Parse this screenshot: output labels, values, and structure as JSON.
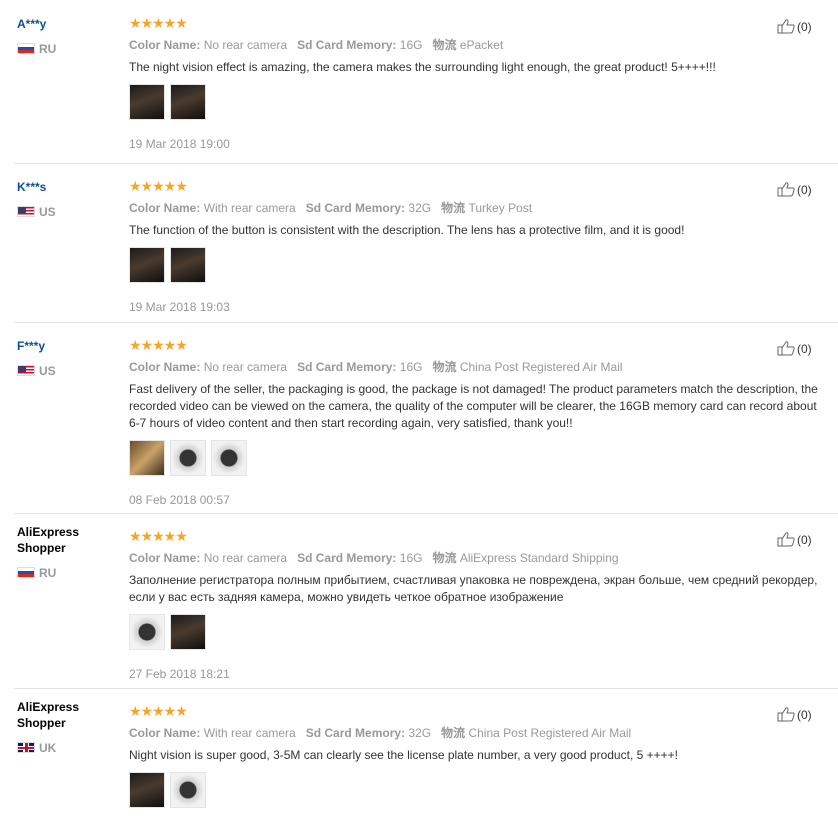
{
  "reviews": [
    {
      "user": "A***y",
      "shopper": false,
      "country": "RU",
      "flag": "ru",
      "stars": "★★★★★",
      "attrs": [
        {
          "key": "Color Name:",
          "val": "No rear camera"
        },
        {
          "key": "Sd Card Memory:",
          "val": "16G"
        },
        {
          "key": "物流",
          "val": "ePacket"
        }
      ],
      "text": "The night vision effect is amazing, the camera makes the surrounding light enough, the great product! 5++++!!!",
      "thumbs": [
        "dark",
        "dark"
      ],
      "date": "19 Mar 2018 19:00",
      "helpful": "(0)"
    },
    {
      "user": "K***s",
      "shopper": false,
      "country": "US",
      "flag": "us",
      "stars": "★★★★★",
      "attrs": [
        {
          "key": "Color Name:",
          "val": "With rear camera"
        },
        {
          "key": "Sd Card Memory:",
          "val": "32G"
        },
        {
          "key": "物流",
          "val": "Turkey Post"
        }
      ],
      "text": "The function of the button is consistent with the description. The lens has a protective film, and it is good!",
      "thumbs": [
        "dark",
        "dark"
      ],
      "date": "19 Mar 2018 19:03",
      "helpful": "(0)"
    },
    {
      "user": "F***y",
      "shopper": false,
      "country": "US",
      "flag": "us",
      "stars": "★★★★★",
      "attrs": [
        {
          "key": "Color Name:",
          "val": "No rear camera"
        },
        {
          "key": "Sd Card Memory:",
          "val": "16G"
        },
        {
          "key": "物流",
          "val": "China Post Registered Air Mail"
        }
      ],
      "text": "Fast delivery of the seller, the packaging is good, the package is not damaged! The product parameters match the description, the recorded video can be viewed on the camera, the quality of the computer will be clearer, the 16GB memory card can record about 6-7 hours of video content and then start recording again, very satisfied, thank you!!",
      "thumbs": [
        "warm",
        "light",
        "light"
      ],
      "date": "08 Feb 2018 00:57",
      "helpful": "(0)"
    },
    {
      "user": "AliExpress Shopper",
      "shopper": true,
      "country": "RU",
      "flag": "ru",
      "stars": "★★★★★",
      "attrs": [
        {
          "key": "Color Name:",
          "val": "No rear camera"
        },
        {
          "key": "Sd Card Memory:",
          "val": "16G"
        },
        {
          "key": "物流",
          "val": "AliExpress Standard Shipping"
        }
      ],
      "text": "Заполнение регистратора полным прибытием, счастливая упаковка не повреждена, экран больше, чем средний рекордер, если у вас есть задняя камера, можно увидеть четкое обратное изображение",
      "thumbs": [
        "light",
        "dark"
      ],
      "date": "27 Feb 2018 18:21",
      "helpful": "(0)"
    },
    {
      "user": "AliExpress Shopper",
      "shopper": true,
      "country": "UK",
      "flag": "uk",
      "stars": "★★★★★",
      "attrs": [
        {
          "key": "Color Name:",
          "val": "With rear camera"
        },
        {
          "key": "Sd Card Memory:",
          "val": "32G"
        },
        {
          "key": "物流",
          "val": "China Post Registered Air Mail"
        }
      ],
      "text": "Night vision is super good, 3-5M can clearly see the license plate number, a very good product, 5 ++++!",
      "thumbs": [
        "dark",
        "light"
      ],
      "date": "",
      "helpful": "(0)"
    }
  ]
}
